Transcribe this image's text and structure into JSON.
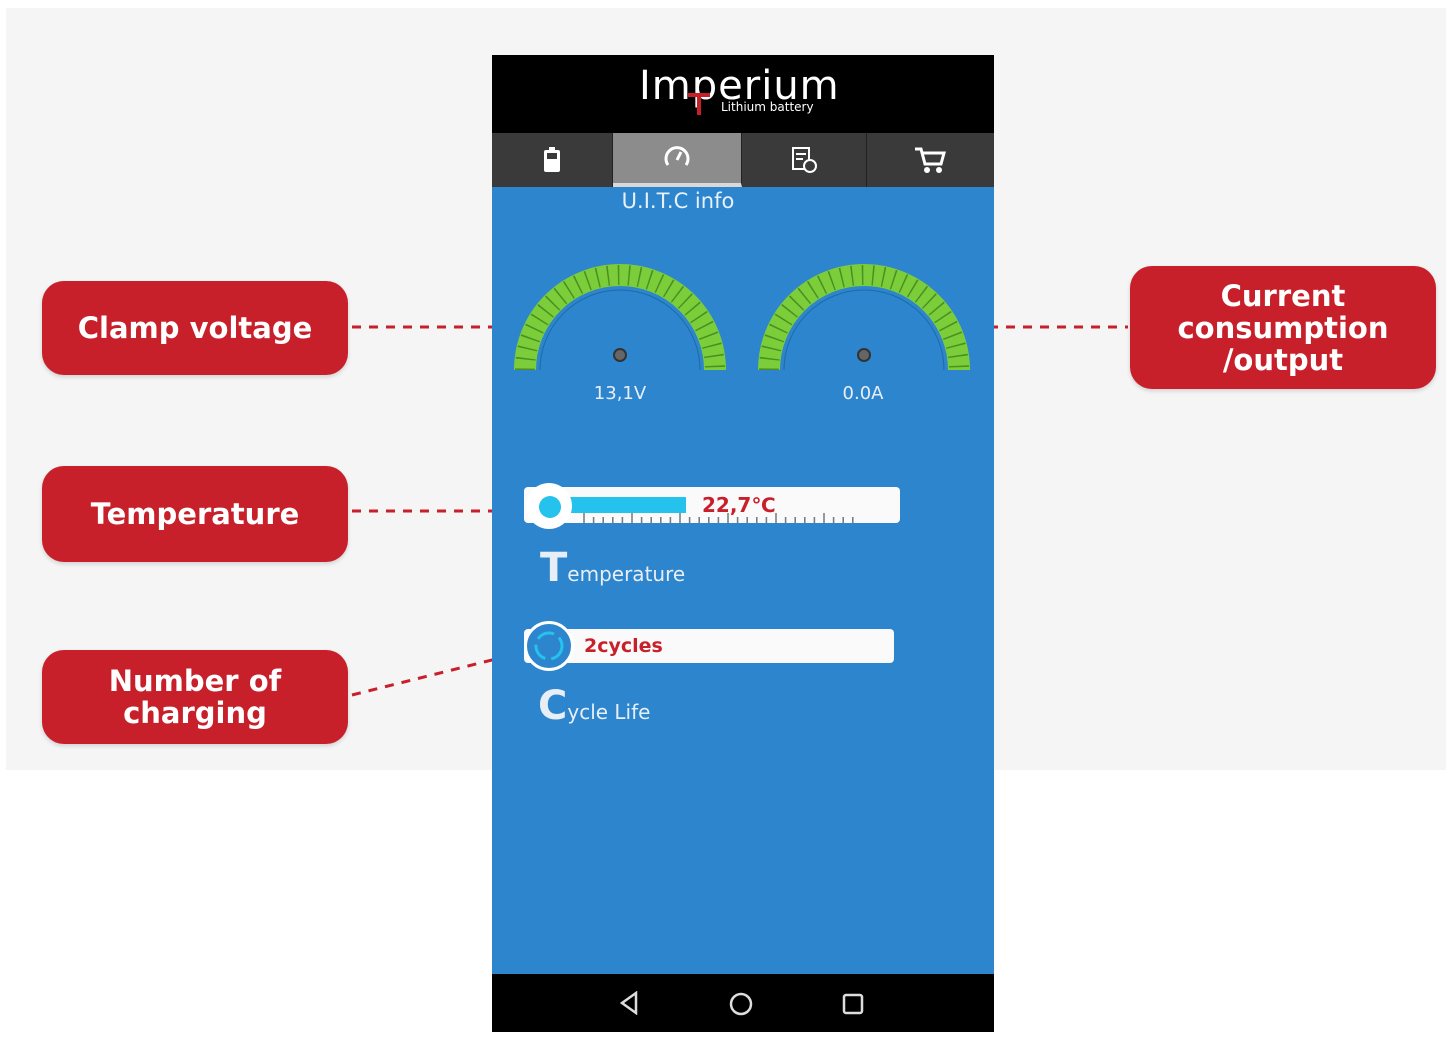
{
  "colors": {
    "brand_red": "#c8202b",
    "screen_blue": "#2d85cd",
    "gauge_green": "#7ccd3a",
    "thermo_blue": "#25c2ee"
  },
  "callouts": {
    "clamp": "Clamp voltage",
    "temperature": "Temperature",
    "charging": [
      "Number of",
      "charging"
    ],
    "current": [
      "Current",
      "consumption",
      "/output"
    ]
  },
  "app": {
    "logo": "Imperium",
    "logo_sub": "Lithium battery",
    "tabs": [
      {
        "icon": "battery-icon",
        "active": false
      },
      {
        "icon": "gauge-icon",
        "active": true
      },
      {
        "icon": "report-icon",
        "active": false
      },
      {
        "icon": "cart-icon",
        "active": false
      }
    ],
    "screen_title": "U.I.T.C info",
    "voltage": {
      "value": "13,1V",
      "level": 0.5
    },
    "current": {
      "value": "0.0A",
      "level": 0.5
    },
    "temperature": {
      "value": "22,7℃",
      "fraction": 0.42,
      "label_initial": "T",
      "label_rest": "emperature"
    },
    "cycles": {
      "value": "2cycles",
      "label_initial": "C",
      "label_rest": "ycle Life"
    },
    "nav": [
      "back-icon",
      "home-icon",
      "recents-icon"
    ]
  }
}
